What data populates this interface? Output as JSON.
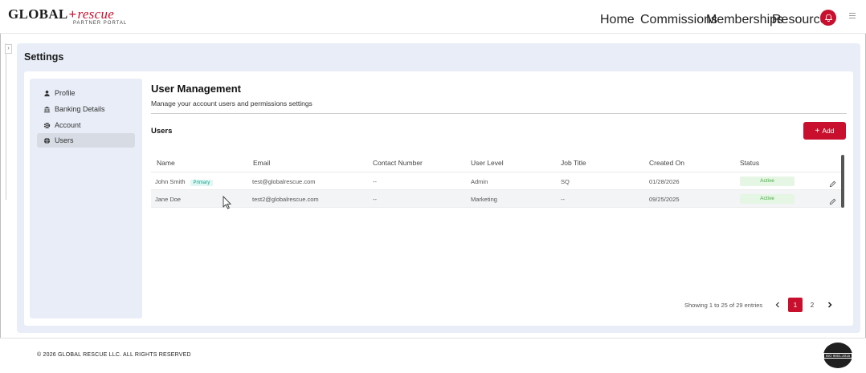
{
  "brand": {
    "logo_main": "GLOBAL",
    "logo_accent": "rescue",
    "logo_sub": "PARTNER PORTAL"
  },
  "nav": {
    "items": [
      {
        "label": "Home"
      },
      {
        "label": "Commissions"
      },
      {
        "label": "Memberships"
      },
      {
        "label": "Resources"
      }
    ],
    "bell_icon": "bell-icon",
    "menu_icon": "hamburger-menu-icon"
  },
  "page": {
    "title": "Settings"
  },
  "sidebar": {
    "items": [
      {
        "label": "Profile",
        "icon": "person-icon",
        "active": false
      },
      {
        "label": "Banking Details",
        "icon": "bank-icon",
        "active": false
      },
      {
        "label": "Account",
        "icon": "gear-icon",
        "active": false
      },
      {
        "label": "Users",
        "icon": "globe-icon",
        "active": true
      }
    ]
  },
  "user_management": {
    "title": "User Management",
    "subtitle": "Manage your account users and permissions settings",
    "users_heading": "Users",
    "add_label": "Add"
  },
  "table": {
    "columns": [
      "Name",
      "Email",
      "Contact Number",
      "User Level",
      "Job Title",
      "Created On",
      "Status"
    ],
    "rows": [
      {
        "name": "John Smith",
        "badge": "Primary",
        "email": "test@globalrescue.com",
        "contact": "--",
        "level": "Admin",
        "job": "SQ",
        "created": "01/28/2026",
        "status": "Active"
      },
      {
        "name": "Jane Doe",
        "badge": "",
        "email": "test2@globalrescue.com",
        "contact": "--",
        "level": "Marketing",
        "job": "--",
        "created": "09/25/2025",
        "status": "Active"
      }
    ]
  },
  "pagination": {
    "info": "Showing 1 to 25 of 29 entries",
    "pages": [
      "1",
      "2"
    ],
    "current": "1",
    "prev_icon": "chevron-left-icon",
    "next_icon": "chevron-right-icon"
  },
  "footer": {
    "copyright": "© 2026 GLOBAL RESCUE LLC. ALL RIGHTS RESERVED",
    "iso_label": "ISO 9001:2015"
  },
  "colors": {
    "brand_red": "#c8102e",
    "panel_bg": "#e8edf7",
    "active_status_bg": "#e6f6e4",
    "active_status_fg": "#3fae3f",
    "primary_badge_fg": "#1aa38b"
  }
}
